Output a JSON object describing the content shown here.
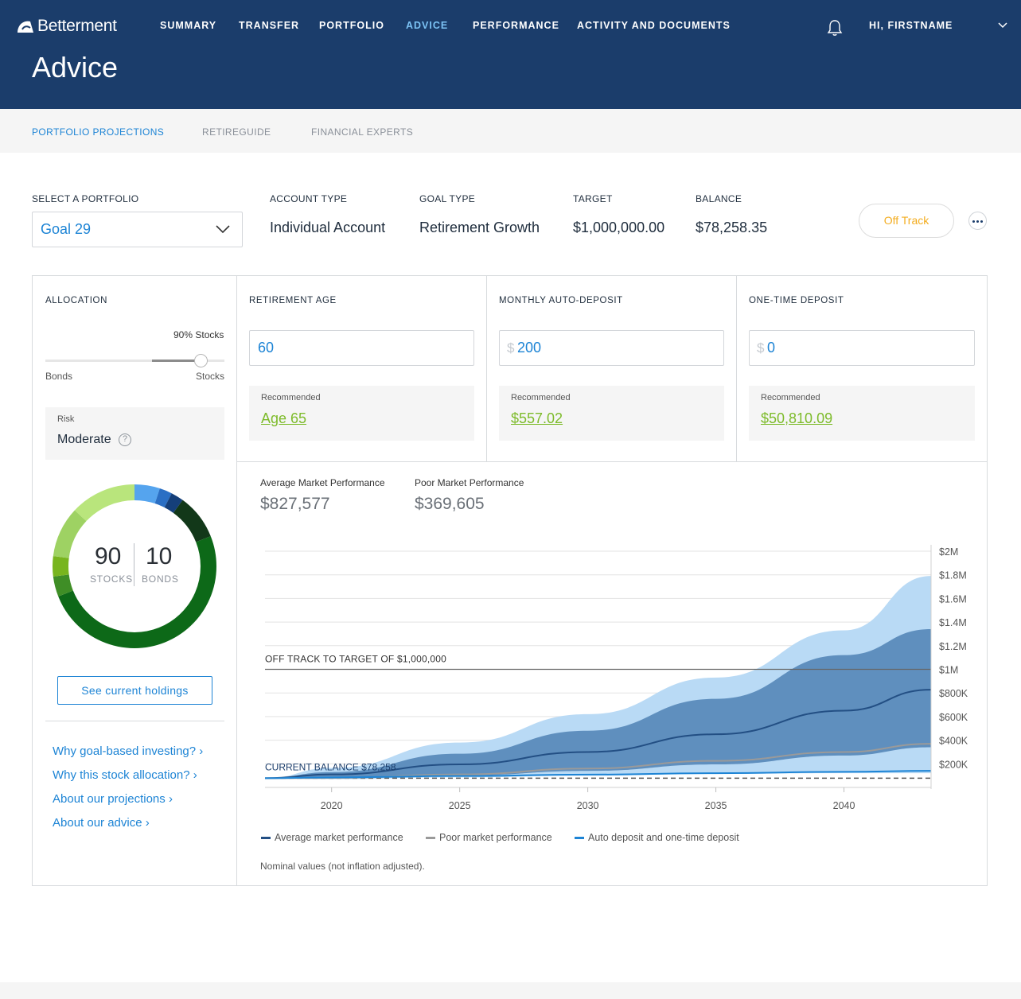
{
  "brand": {
    "name": "Betterment"
  },
  "nav": {
    "items": [
      "SUMMARY",
      "TRANSFER",
      "PORTFOLIO",
      "ADVICE",
      "PERFORMANCE",
      "ACTIVITY AND DOCUMENTS"
    ],
    "active": "ADVICE",
    "user_label": "HI, FIRSTNAME"
  },
  "page": {
    "title": "Advice"
  },
  "subnav": {
    "tabs": [
      "PORTFOLIO PROJECTIONS",
      "RETIREGUIDE",
      "FINANCIAL EXPERTS"
    ],
    "active": "PORTFOLIO PROJECTIONS"
  },
  "summary": {
    "select_label": "SELECT A PORTFOLIO",
    "selected_portfolio": "Goal 29",
    "account_type_label": "ACCOUNT TYPE",
    "account_type": "Individual Account",
    "goal_type_label": "GOAL TYPE",
    "goal_type": "Retirement Growth",
    "target_label": "TARGET",
    "target": "$1,000,000.00",
    "balance_label": "BALANCE",
    "balance": "$78,258.35",
    "status": "Off Track"
  },
  "allocation": {
    "label": "ALLOCATION",
    "stocks_pct_label": "90% Stocks",
    "stocks_fraction": 0.9,
    "left_label": "Bonds",
    "right_label": "Stocks",
    "risk_label": "Risk",
    "risk_value": "Moderate",
    "help_glyph": "?",
    "stocks": "90",
    "bonds": "10",
    "stocks_caption": "STOCKS",
    "bonds_caption": "BONDS",
    "holdings_button": "See current holdings",
    "links": [
      "Why goal-based investing?",
      "Why this stock allocation?",
      "About our projections",
      "About our advice"
    ],
    "link_arrow": "›"
  },
  "inputs": {
    "retirement_age_label": "RETIREMENT AGE",
    "retirement_age": "60",
    "monthly_label": "MONTHLY AUTO-DEPOSIT",
    "monthly": "200",
    "one_time_label": "ONE-TIME DEPOSIT",
    "one_time": "0",
    "currency_prefix": "$",
    "recommended_label": "Recommended",
    "rec_age": "Age 65",
    "rec_monthly": "$557.02",
    "rec_one_time": "$50,810.09"
  },
  "projection": {
    "avg_label": "Average Market Performance",
    "avg_value": "$827,577",
    "poor_label": "Poor Market Performance",
    "poor_value": "$369,605",
    "legend": [
      "Average market performance",
      "Poor market performance",
      "Auto deposit and one-time deposit"
    ],
    "note": "Nominal values (not inflation adjusted)."
  },
  "colors": {
    "header": "#1b3d6b",
    "accent": "#1d84d5",
    "off_track": "#f3ac1e",
    "recommended": "#7dbb2a",
    "band_outer": "#b9daf5",
    "band_inner": "#5f8fbe",
    "avg_line": "#234f84",
    "poor_line": "#9a9a9a",
    "deposit_line": "#1d84d5"
  },
  "chart_data": {
    "type": "area",
    "xlabel": "",
    "ylabel": "",
    "x_ticks": [
      2020,
      2025,
      2030,
      2035,
      2040
    ],
    "y_ticks": [
      200000,
      400000,
      600000,
      800000,
      1000000,
      1200000,
      1400000,
      1600000,
      1800000,
      2000000
    ],
    "y_tick_labels": [
      "$200K",
      "$400K",
      "$600K",
      "$800K",
      "$1M",
      "$1.2M",
      "$1.4M",
      "$1.6M",
      "$1.8M",
      "$2M"
    ],
    "xlim": [
      2017.4,
      2043.4
    ],
    "ylim": [
      0,
      2000000
    ],
    "target_line": {
      "value": 1000000,
      "label": "OFF TRACK TO TARGET OF $1,000,000"
    },
    "current_balance": {
      "value": 78258,
      "label": "CURRENT BALANCE $78,258"
    },
    "x": [
      2017.4,
      2020,
      2025,
      2030,
      2035,
      2040,
      2043.4
    ],
    "series": [
      {
        "name": "outer band upper",
        "values": [
          78258,
          165000,
          380000,
          620000,
          930000,
          1330000,
          1790000
        ]
      },
      {
        "name": "inner band upper",
        "values": [
          78258,
          130000,
          285000,
          480000,
          750000,
          1120000,
          1340000
        ]
      },
      {
        "name": "Average market performance",
        "values": [
          78258,
          110000,
          195000,
          300000,
          450000,
          650000,
          827577
        ]
      },
      {
        "name": "Poor market performance",
        "values": [
          78258,
          80000,
          110000,
          160000,
          225000,
          300000,
          369605
        ]
      },
      {
        "name": "inner band lower",
        "values": [
          78258,
          78000,
          100000,
          140000,
          195000,
          270000,
          340000
        ]
      },
      {
        "name": "outer band lower",
        "values": [
          78258,
          70000,
          85000,
          100000,
          115000,
          120000,
          120000
        ]
      },
      {
        "name": "Auto deposit and one-time deposit",
        "values": [
          78258,
          84500,
          96500,
          108500,
          120500,
          132500,
          140600
        ]
      }
    ]
  }
}
